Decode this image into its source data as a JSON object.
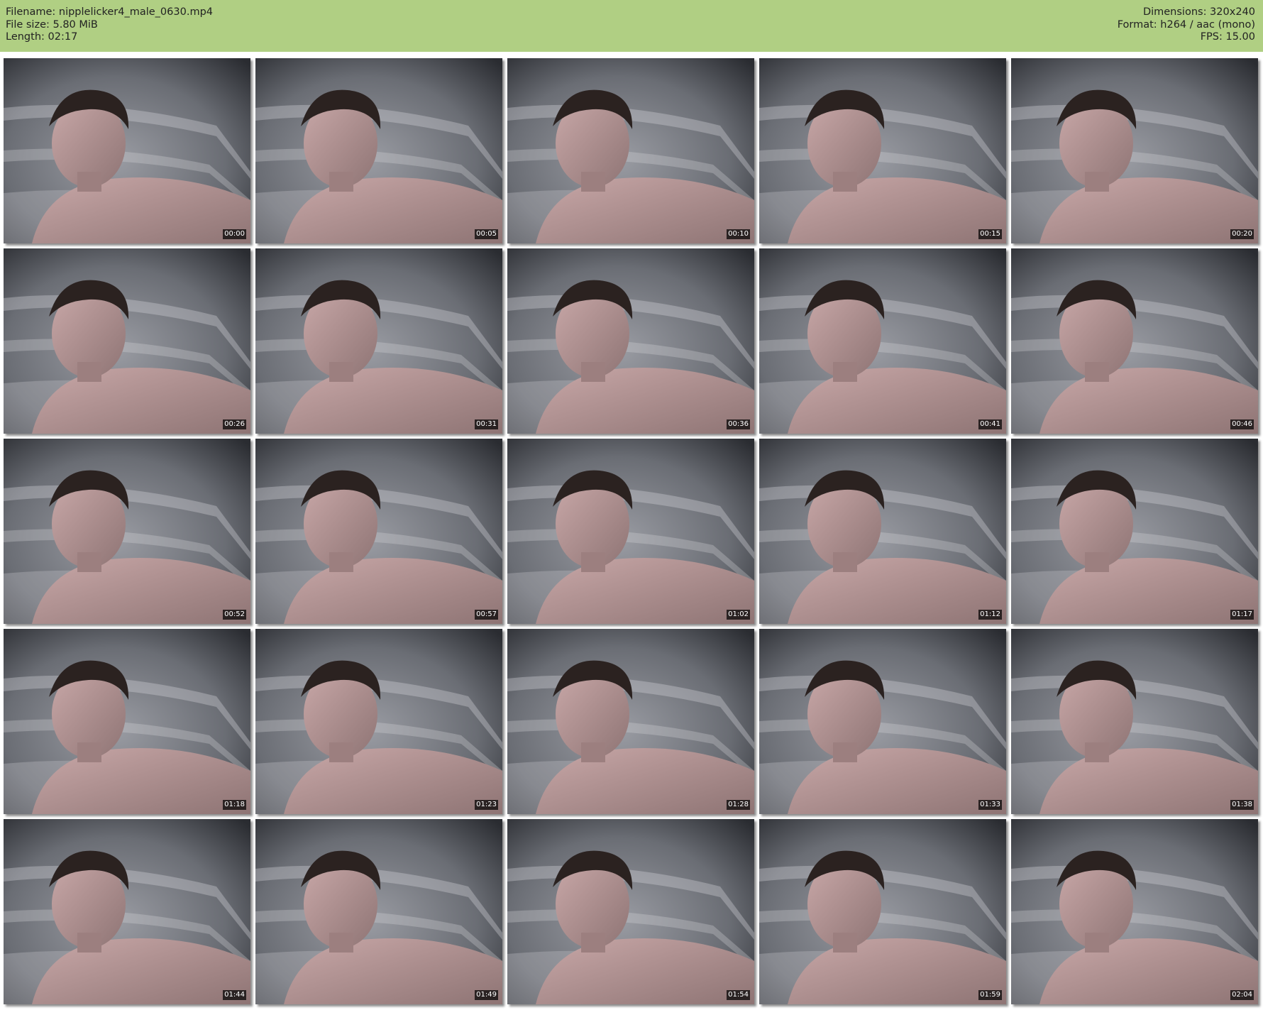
{
  "header": {
    "filename_line": "Filename: nipplelicker4_male_0630.mp4",
    "filesize_line": "File size: 5.80 MiB",
    "length_line": "Length: 02:17",
    "dimensions_line": "Dimensions: 320x240",
    "format_line": "Format: h264 / aac (mono)",
    "fps_line": "FPS: 15.00"
  },
  "colors": {
    "header_bg": "#b0cf83",
    "page_bg": "#ffffff",
    "timestamp_bg": "#000000",
    "timestamp_text": "#ffffff"
  },
  "thumbnails": [
    {
      "timestamp": "00:00"
    },
    {
      "timestamp": "00:05"
    },
    {
      "timestamp": "00:10"
    },
    {
      "timestamp": "00:15"
    },
    {
      "timestamp": "00:20"
    },
    {
      "timestamp": "00:26"
    },
    {
      "timestamp": "00:31"
    },
    {
      "timestamp": "00:36"
    },
    {
      "timestamp": "00:41"
    },
    {
      "timestamp": "00:46"
    },
    {
      "timestamp": "00:52"
    },
    {
      "timestamp": "00:57"
    },
    {
      "timestamp": "01:02"
    },
    {
      "timestamp": "01:12"
    },
    {
      "timestamp": "01:17"
    },
    {
      "timestamp": "01:18"
    },
    {
      "timestamp": "01:23"
    },
    {
      "timestamp": "01:28"
    },
    {
      "timestamp": "01:33"
    },
    {
      "timestamp": "01:38"
    },
    {
      "timestamp": "01:44"
    },
    {
      "timestamp": "01:49"
    },
    {
      "timestamp": "01:54"
    },
    {
      "timestamp": "01:59"
    },
    {
      "timestamp": "02:04"
    }
  ]
}
